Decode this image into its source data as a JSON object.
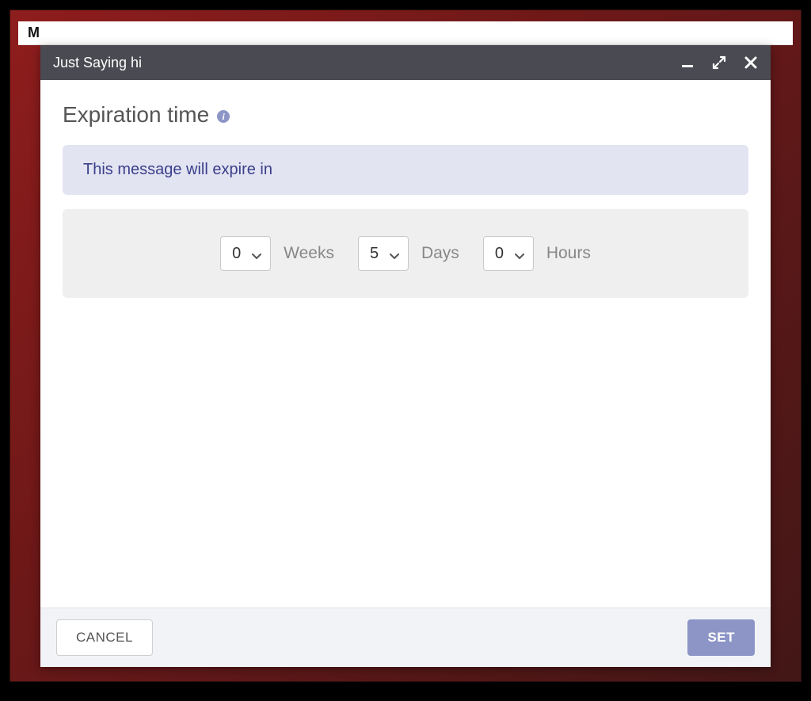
{
  "dialog": {
    "title": "Just Saying hi",
    "section_title": "Expiration time",
    "info_icon_label": "i",
    "banner_text": "This message will expire in",
    "weeks": {
      "value": "0",
      "label": "Weeks"
    },
    "days": {
      "value": "5",
      "label": "Days"
    },
    "hours": {
      "value": "0",
      "label": "Hours"
    },
    "cancel_label": "CANCEL",
    "set_label": "SET"
  }
}
